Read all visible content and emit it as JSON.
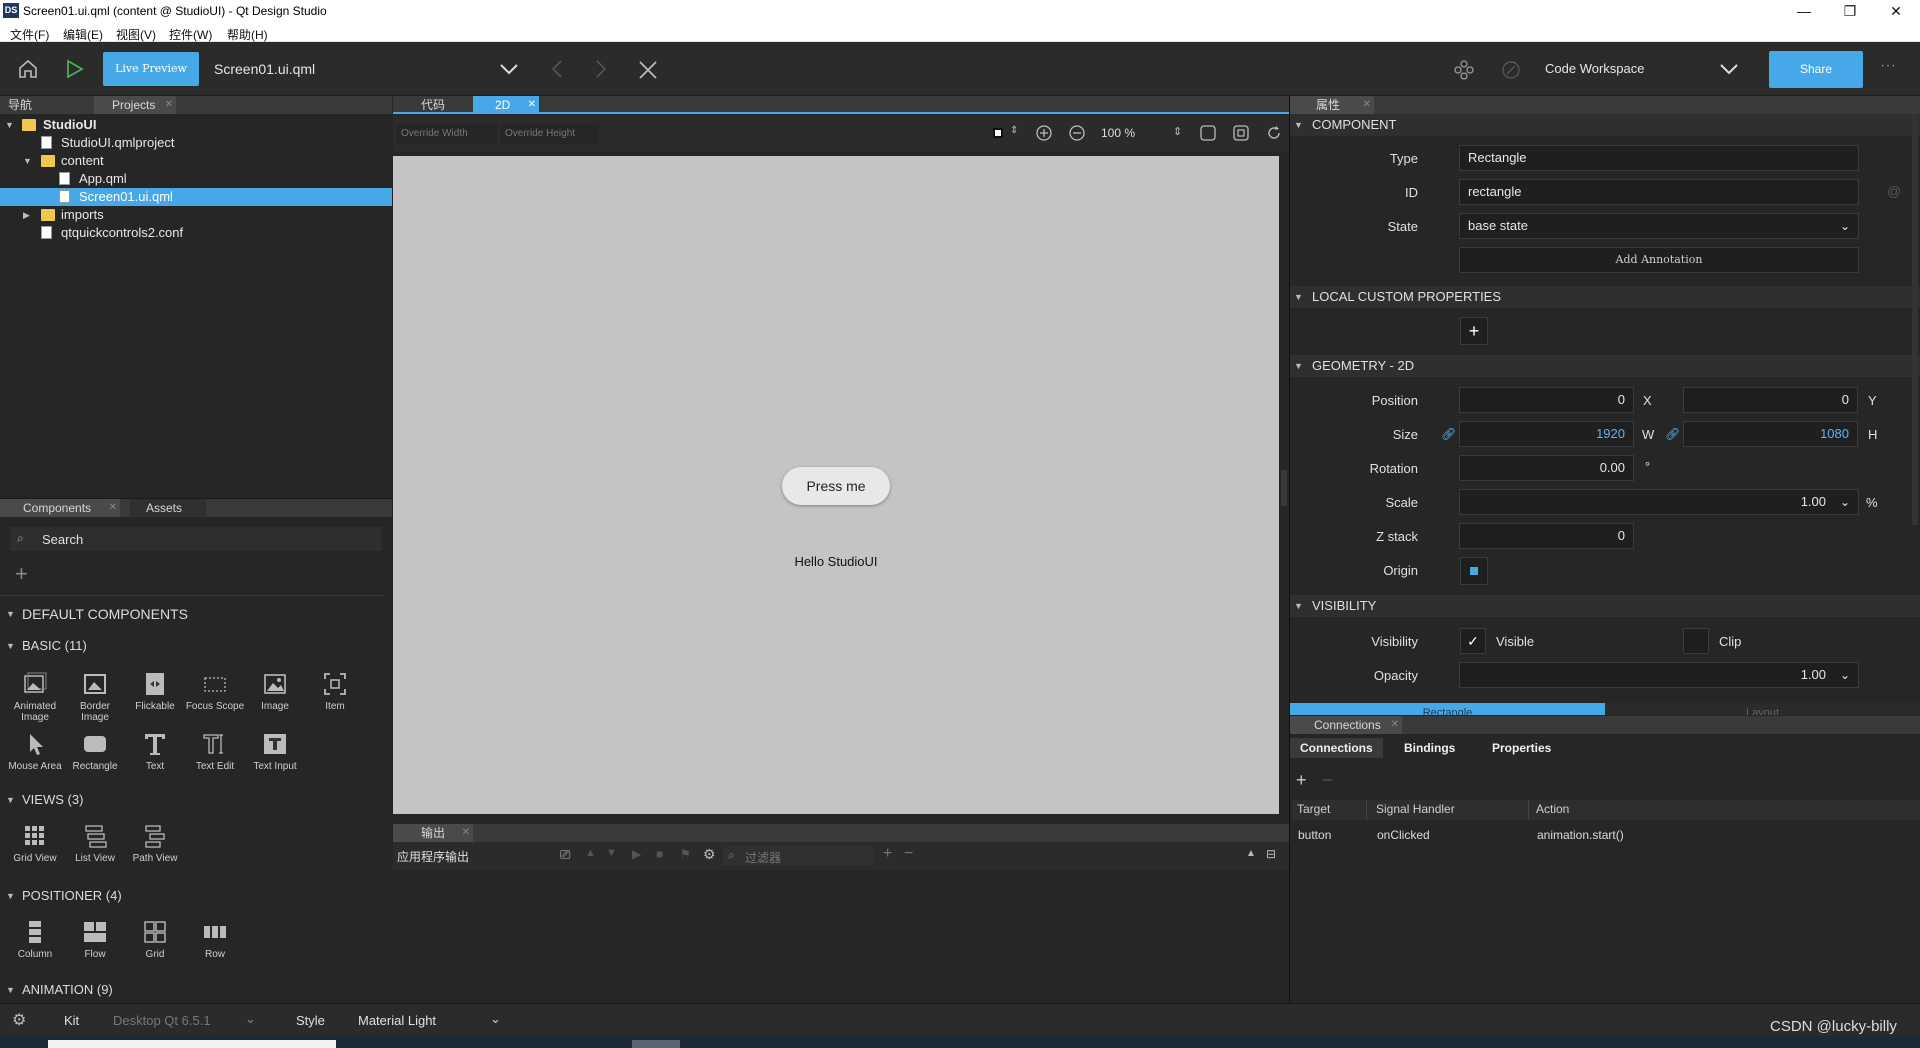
{
  "window": {
    "app_icon": "DS",
    "title": "Screen01.ui.qml (content @ StudioUI) - Qt Design Studio",
    "controls": [
      "minimize-icon",
      "restore-icon",
      "close-icon"
    ]
  },
  "menu": [
    "文件(F)",
    "编辑(E)",
    "视图(V)",
    "控件(W)",
    "帮助(H)"
  ],
  "toolbar": {
    "live_preview": "Live Preview",
    "current_file": "Screen01.ui.qml",
    "workspace": "Code Workspace",
    "share": "Share",
    "more": "···"
  },
  "left_tabs": {
    "nav": "导航",
    "projects": "Projects"
  },
  "project_tree": [
    {
      "label": "StudioUI",
      "type": "project"
    },
    {
      "label": "StudioUI.qmlproject",
      "type": "file"
    },
    {
      "label": "content",
      "type": "folder"
    },
    {
      "label": "App.qml",
      "type": "file"
    },
    {
      "label": "Screen01.ui.qml",
      "type": "file",
      "selected": true
    },
    {
      "label": "imports",
      "type": "folder"
    },
    {
      "label": "qtquickcontrols2.conf",
      "type": "file"
    }
  ],
  "library": {
    "tabs": {
      "components": "Components",
      "assets": "Assets"
    },
    "search_placeholder": "Search",
    "default_components": "DEFAULT COMPONENTS",
    "basic": {
      "title": "BASIC (11)",
      "items": [
        [
          "Animated",
          "Image"
        ],
        [
          "Border",
          "Image"
        ],
        [
          "Flickable"
        ],
        [
          "Focus Scope"
        ],
        [
          "Image"
        ],
        [
          "Item"
        ],
        [
          "Mouse Area"
        ],
        [
          "Rectangle"
        ],
        [
          "Text"
        ],
        [
          "Text Edit"
        ],
        [
          "Text Input"
        ]
      ]
    },
    "views": {
      "title": "VIEWS (3)",
      "items": [
        "Grid View",
        "List View",
        "Path View"
      ]
    },
    "positioner": {
      "title": "POSITIONER (4)",
      "items": [
        "Column",
        "Flow",
        "Grid",
        "Row"
      ]
    },
    "animation": {
      "title": "ANIMATION (9)"
    }
  },
  "editor": {
    "tabs": {
      "code": "代码",
      "design": "2D"
    },
    "override_width": "Override Width",
    "override_height": "Override Height",
    "zoom": "100 %",
    "canvas_button": "Press me",
    "canvas_text": "Hello StudioUI"
  },
  "output": {
    "tab": "输出",
    "app_output": "应用程序输出",
    "filter_placeholder": "过滤器"
  },
  "properties": {
    "tab": "属性",
    "component": {
      "title": "COMPONENT",
      "type_label": "Type",
      "type": "Rectangle",
      "id_label": "ID",
      "id": "rectangle",
      "state_label": "State",
      "state": "base state",
      "annotation": "Add Annotation"
    },
    "local_custom": {
      "title": "LOCAL CUSTOM PROPERTIES"
    },
    "geometry": {
      "title": "GEOMETRY - 2D",
      "position_label": "Position",
      "x": "0",
      "x_axis": "X",
      "y": "0",
      "y_axis": "Y",
      "size_label": "Size",
      "w": "1920",
      "w_axis": "W",
      "h": "1080",
      "h_axis": "H",
      "rotation_label": "Rotation",
      "rotation": "0.00",
      "rotation_unit": "°",
      "scale_label": "Scale",
      "scale": "1.00",
      "scale_unit": "%",
      "zstack_label": "Z stack",
      "zstack": "0",
      "origin_label": "Origin"
    },
    "visibility": {
      "title": "VISIBILITY",
      "visibility_label": "Visibility",
      "visible": "Visible",
      "visible_checked": true,
      "clip": "Clip",
      "opacity_label": "Opacity",
      "opacity": "1.00"
    },
    "bottom_tabs": {
      "rectangle": "Rectangle",
      "layout": "Layout"
    }
  },
  "connections": {
    "panel_tab": "Connections",
    "tabs": [
      "Connections",
      "Bindings",
      "Properties"
    ],
    "headers": [
      "Target",
      "Signal Handler",
      "Action"
    ],
    "rows": [
      {
        "target": "button",
        "signal": "onClicked",
        "action": "animation.start()"
      }
    ]
  },
  "statusbar": {
    "kit_label": "Kit",
    "kit": "Desktop Qt 6.5.1",
    "style_label": "Style",
    "style": "Material Light",
    "watermark": "CSDN @lucky-billy"
  },
  "colors": {
    "accent": "#47a8e8",
    "canvas": "#c4c4c4",
    "panel": "#262626"
  }
}
